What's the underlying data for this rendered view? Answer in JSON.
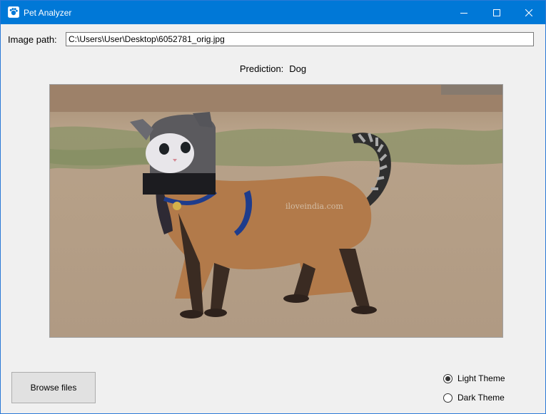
{
  "window": {
    "title": "Pet Analyzer",
    "accent_color": "#0078d7",
    "icons": [
      "app-icon",
      "minimize-icon",
      "maximize-icon",
      "close-icon"
    ]
  },
  "form": {
    "path_label": "Image path:",
    "path_value": "C:\\Users\\User\\Desktop\\6052781_orig.jpg"
  },
  "result": {
    "prediction_label": "Prediction:",
    "prediction_value": "Dog"
  },
  "preview": {
    "watermark": "iloveindia.com"
  },
  "actions": {
    "browse_label": "Browse files"
  },
  "theme": {
    "options": [
      {
        "label": "Light Theme",
        "selected": true
      },
      {
        "label": "Dark Theme",
        "selected": false
      }
    ]
  }
}
